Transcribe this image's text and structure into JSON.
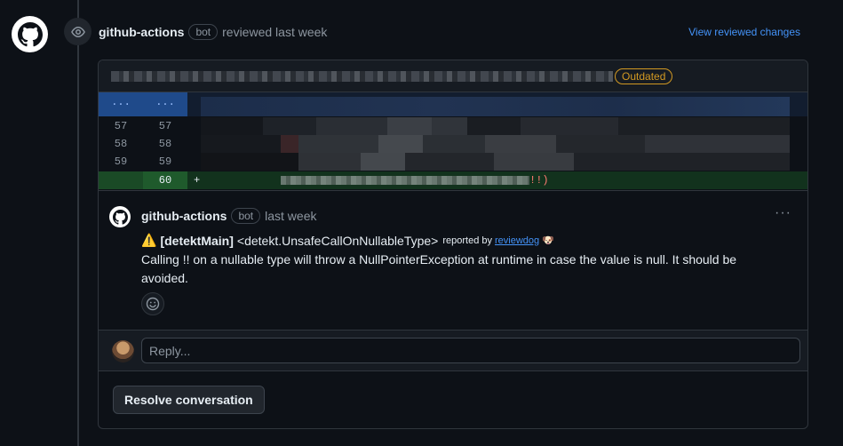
{
  "review": {
    "author": "github-actions",
    "bot_label": "bot",
    "action_text": "reviewed last week",
    "view_changes_label": "View reviewed changes"
  },
  "file": {
    "outdated_label": "Outdated"
  },
  "diff": {
    "hunk_marker": "...",
    "rows": [
      {
        "old": "57",
        "new": "57"
      },
      {
        "old": "58",
        "new": "58"
      },
      {
        "old": "59",
        "new": "59"
      },
      {
        "old": "",
        "new": "60",
        "prefix": "+",
        "code_tail": "!!)"
      }
    ]
  },
  "comment": {
    "author": "github-actions",
    "bot_label": "bot",
    "time": "last week",
    "more_label": "···",
    "warning_icon": "⚠️",
    "tag": "[detektMain]",
    "rule": "<detekt.UnsafeCallOnNullableType>",
    "reported_by": "reported by",
    "reporter": "reviewdog",
    "reporter_icon": "🐶",
    "body": "Calling !! on a nullable type will throw a NullPointerException at runtime in case the value is null. It should be avoided."
  },
  "reply": {
    "placeholder": "Reply..."
  },
  "resolve_label": "Resolve conversation",
  "colors": {
    "background": "#0d1117",
    "link": "#4493f8",
    "outdated": "#d29922",
    "added_line": "#12321d"
  }
}
